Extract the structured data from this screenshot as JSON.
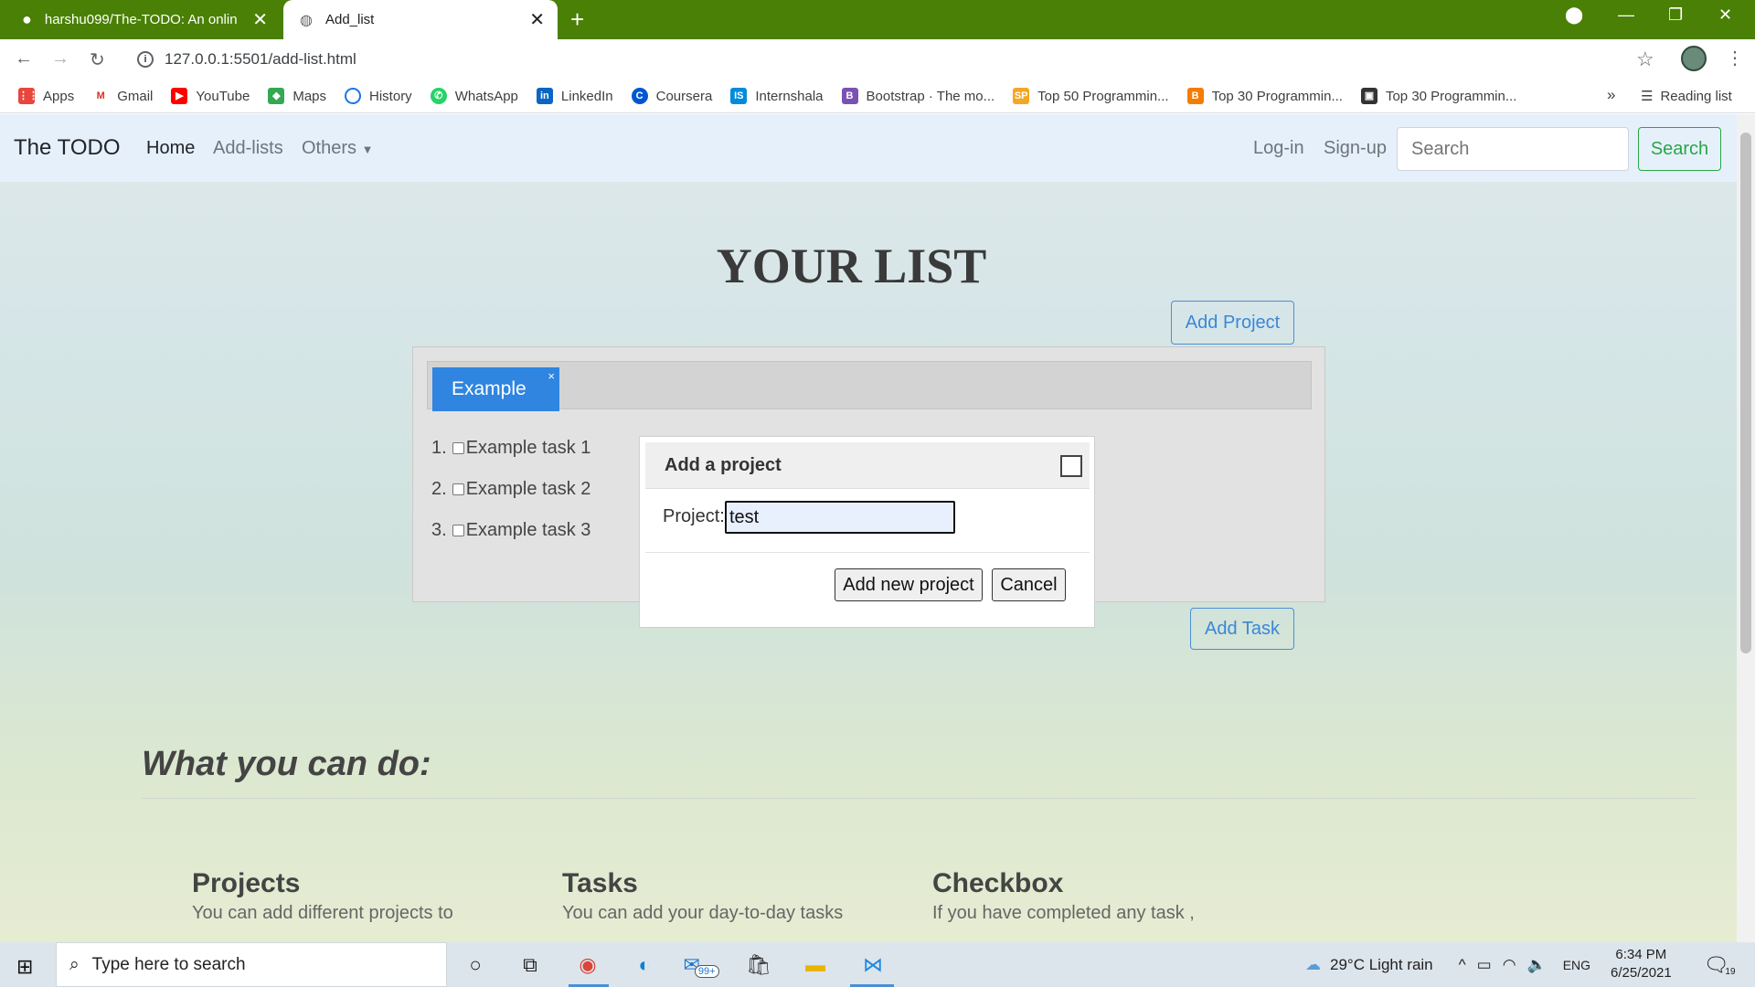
{
  "browser": {
    "tabs": [
      {
        "title": "harshu099/The-TODO: An online"
      },
      {
        "title": "Add_list"
      }
    ],
    "address": "127.0.0.1:5501/add-list.html",
    "bookmarks": [
      "Apps",
      "Gmail",
      "YouTube",
      "Maps",
      "History",
      "WhatsApp",
      "LinkedIn",
      "Coursera",
      "Internshala",
      "Bootstrap · The mo...",
      "Top 50 Programmin...",
      "Top 30 Programmin...",
      "Top 30 Programmin..."
    ],
    "reading_list": "Reading list"
  },
  "navbar": {
    "brand": "The TODO",
    "links": [
      "Home",
      "Add-lists",
      "Others"
    ],
    "login": "Log-in",
    "signup": "Sign-up",
    "search_placeholder": "Search",
    "search_button": "Search"
  },
  "main": {
    "heading": "YOUR LIST",
    "add_project": "Add Project",
    "add_task": "Add Task",
    "project_tab": "Example",
    "tab_close": "×",
    "tasks": [
      "Example task 1",
      "Example task 2",
      "Example task 3"
    ]
  },
  "modal": {
    "title": "Add a project",
    "label": "Project:",
    "value": "test",
    "add_button": "Add new project",
    "cancel_button": "Cancel"
  },
  "features": {
    "heading": "What you can do:",
    "items": [
      {
        "title": "Projects",
        "text": "You can add different projects to"
      },
      {
        "title": "Tasks",
        "text": "You can add your day-to-day tasks"
      },
      {
        "title": "Checkbox",
        "text": "If you have completed any task ,"
      }
    ]
  },
  "taskbar": {
    "search_placeholder": "Type here to search",
    "mail_badge": "99+",
    "weather": "29°C  Light rain",
    "lang": "ENG",
    "time": "6:34 PM",
    "date": "6/25/2021",
    "notifications": "19"
  }
}
